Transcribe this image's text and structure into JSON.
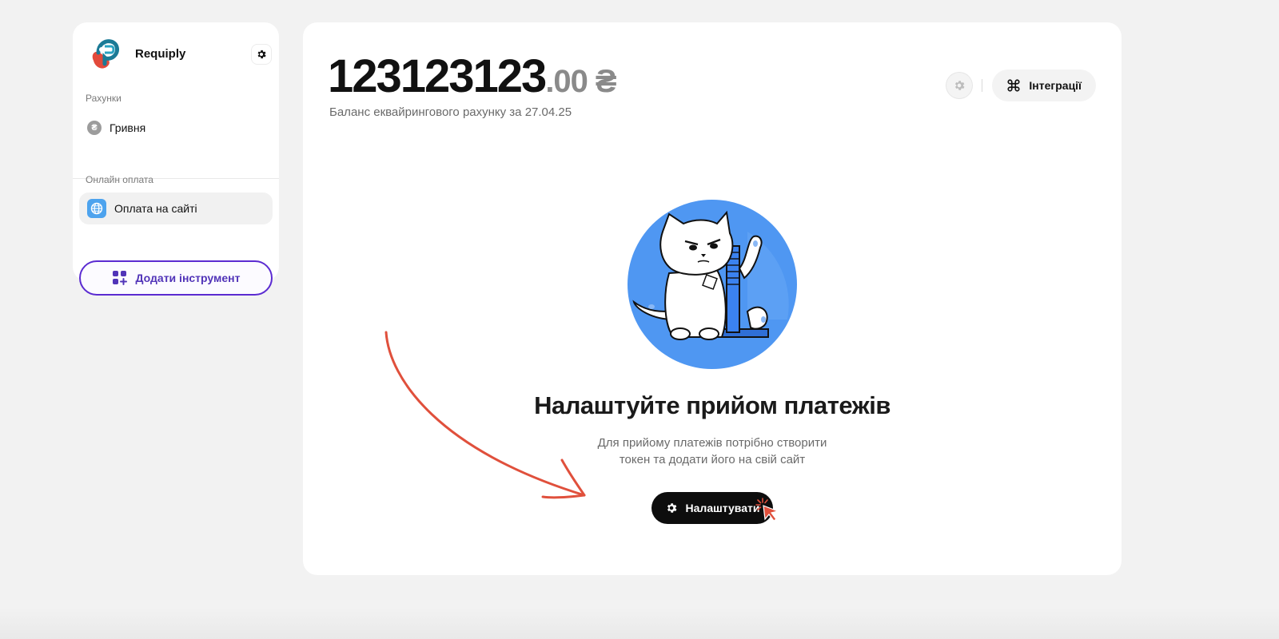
{
  "sidebar": {
    "brand_name": "Requiply",
    "accounts_section_label": "Рахунки",
    "accounts": [
      {
        "label": "Гривня",
        "icon": "hryvnia-coin-icon",
        "icon_glyph": "₴"
      }
    ],
    "online_section_label": "Онлайн оплата",
    "online_items": [
      {
        "label": "Оплата на сайті",
        "icon": "globe-icon",
        "active": true
      }
    ],
    "add_tool_label": "Додати інструмент"
  },
  "main": {
    "balance_whole": "123123123",
    "balance_cents": ".00",
    "balance_currency": "₴",
    "balance_caption": "Баланс еквайрингового рахунку за 27.04.25",
    "integrations_label": "Інтеграції",
    "empty_state": {
      "title": "Налаштуйте прийом платежів",
      "description_line1": "Для прийому платежів потрібно створити",
      "description_line2": "токен та додати його на свій сайт",
      "button_label": "Налаштувати"
    }
  },
  "colors": {
    "page_bg": "#f2f2f2",
    "card_bg": "#ffffff",
    "accent_purple": "#5b2bd1",
    "globe_blue": "#4da3ee",
    "illustration_blue": "#4f97f2",
    "annotation_red": "#e0503c",
    "button_dark": "#0d0d0d"
  }
}
